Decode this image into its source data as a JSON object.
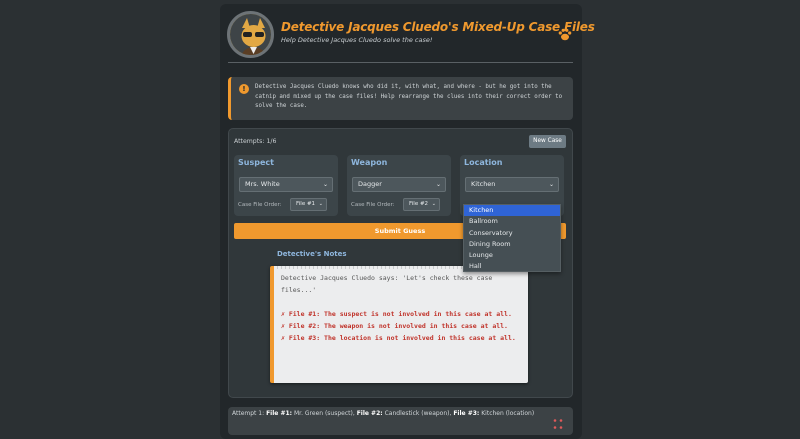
{
  "header": {
    "title": "Detective Jacques Cluedo's Mixed-Up Case Files",
    "subtitle": "Help Detective Jacques Cluedo solve the case!",
    "avatar_icon": "cat-detective-avatar",
    "paw_icon": "paw-icon"
  },
  "info": {
    "icon": "info-icon",
    "text": "Detective Jacques Cluedo knows who did it, with what, and where - but he got into the catnip and mixed up the case files! Help rearrange the clues into their correct order to solve the case."
  },
  "game": {
    "attempts": "Attempts: 1/6",
    "new_case_label": "New Case",
    "submit_label": "Submit Guess"
  },
  "cards": [
    {
      "title": "Suspect",
      "selected": "Mrs. White",
      "order_label": "Case File Order:",
      "order_value": "File #1"
    },
    {
      "title": "Weapon",
      "selected": "Dagger",
      "order_label": "Case File Order:",
      "order_value": "File #2"
    },
    {
      "title": "Location",
      "selected": "Kitchen",
      "order_label": "Case File Order:",
      "order_value": ""
    }
  ],
  "dropdown": {
    "options": [
      "Kitchen",
      "Ballroom",
      "Conservatory",
      "Dining Room",
      "Lounge",
      "Hall"
    ],
    "highlighted": "Kitchen"
  },
  "notes": {
    "title": "Detective's Notes",
    "intro": "Detective Jacques Cluedo says: 'Let's check these case files...'",
    "clues": [
      "✗ File #1: The suspect is not involved in this case at all.",
      "✗ File #2: The weapon is not involved in this case at all.",
      "✗ File #3: The location is not involved in this case at all."
    ]
  },
  "history": {
    "prefix": "Attempt 1:",
    "f1_label": "File #1:",
    "f1_value": "Mr. Green (suspect),",
    "f2_label": "File #2:",
    "f2_value": "Candlestick (weapon),",
    "f3_label": "File #3:",
    "f3_value": "Kitchen (location)"
  },
  "colors": {
    "accent": "#f0992e",
    "heading": "#8eb6dd",
    "clue": "#c0332a",
    "highlight": "#2f64d6"
  }
}
